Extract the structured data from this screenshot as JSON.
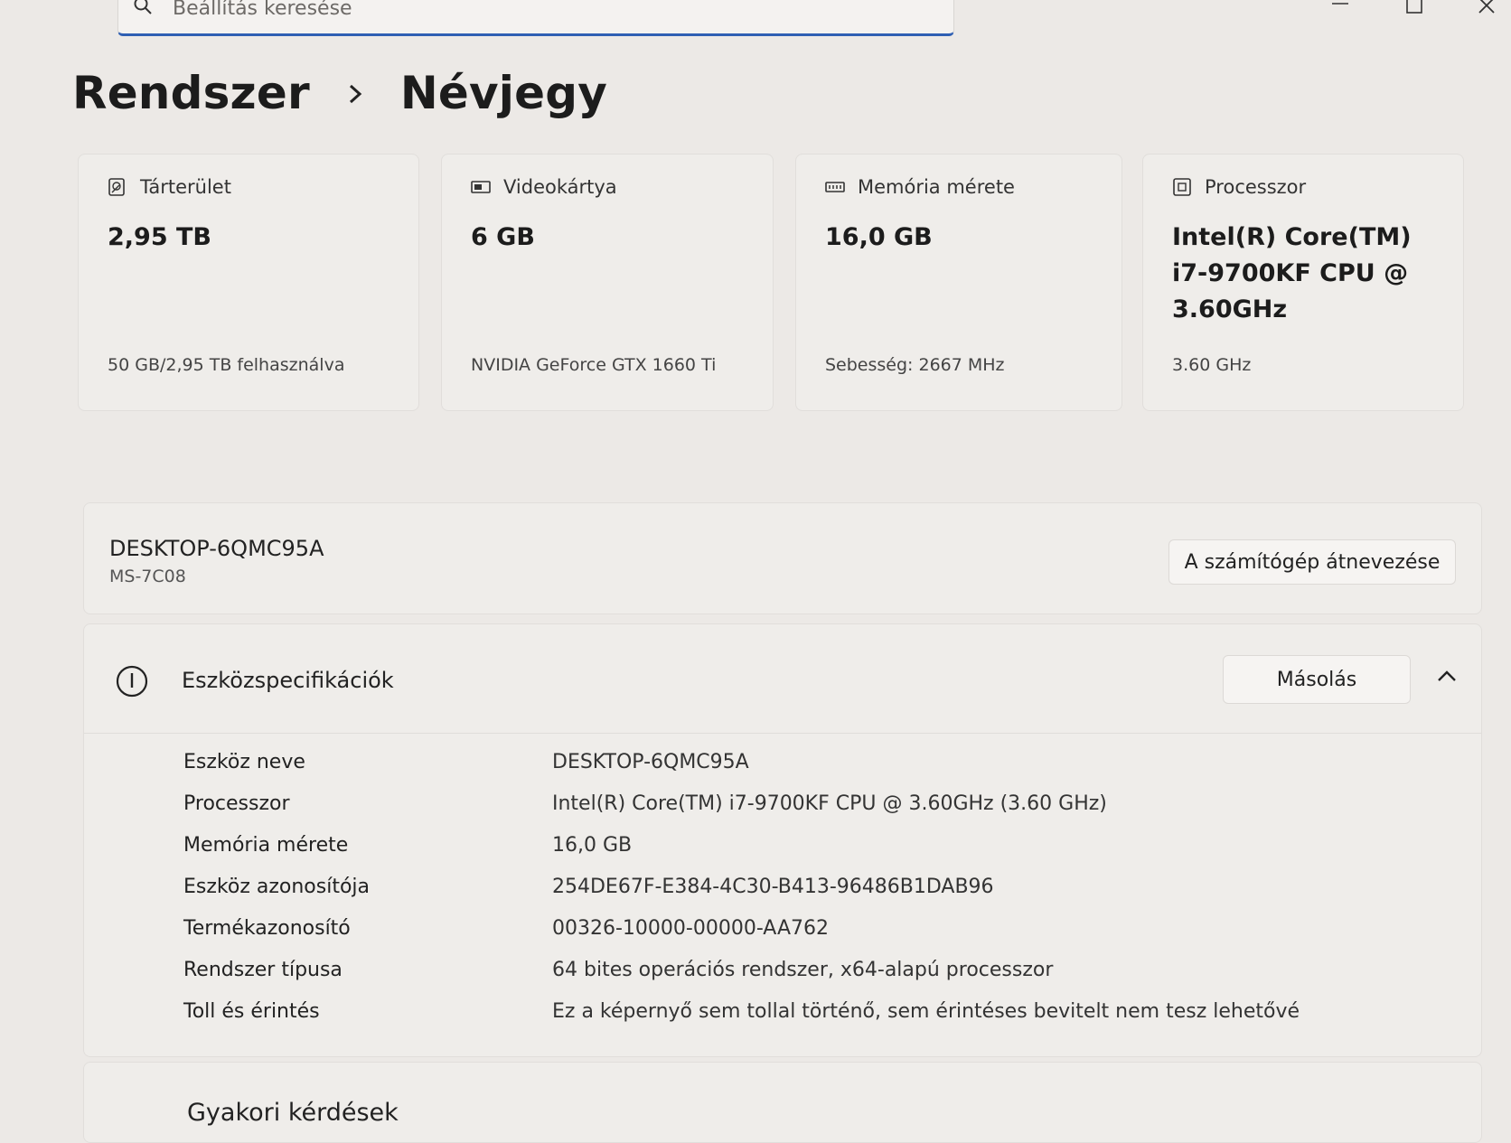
{
  "search": {
    "placeholder": "Beállítás keresése"
  },
  "breadcrumb": {
    "parent": "Rendszer",
    "current": "Névjegy"
  },
  "cards": [
    {
      "icon": "storage-icon",
      "label": "Tárterület",
      "value": "2,95 TB",
      "sub": "50 GB/2,95 TB felhasználva"
    },
    {
      "icon": "gpu-icon",
      "label": "Videokártya",
      "value": "6 GB",
      "sub": "NVIDIA GeForce GTX 1660 Ti"
    },
    {
      "icon": "memory-icon",
      "label": "Memória mérete",
      "value": "16,0 GB",
      "sub": "Sebesség: 2667 MHz"
    },
    {
      "icon": "processor-icon",
      "label": "Processzor",
      "value": "Intel(R) Core(TM) i7-9700KF CPU @ 3.60GHz",
      "sub": "3.60 GHz"
    }
  ],
  "device": {
    "name": "DESKTOP-6QMC95A",
    "model": "MS-7C08",
    "rename_label": "A számítógép átnevezése"
  },
  "specs": {
    "title": "Eszközspecifikációk",
    "copy_label": "Másolás",
    "rows": [
      {
        "key": "Eszköz neve",
        "value": "DESKTOP-6QMC95A"
      },
      {
        "key": "Processzor",
        "value": "Intel(R) Core(TM) i7-9700KF CPU @ 3.60GHz (3.60 GHz)"
      },
      {
        "key": "Memória mérete",
        "value": "16,0 GB"
      },
      {
        "key": "Eszköz azonosítója",
        "value": "254DE67F-E384-4C30-B413-96486B1DAB96"
      },
      {
        "key": "Termékazonosító",
        "value": "00326-10000-00000-AA762"
      },
      {
        "key": "Rendszer típusa",
        "value": "64 bites operációs rendszer, x64-alapú processzor"
      },
      {
        "key": "Toll és érintés",
        "value": "Ez a képernyő sem tollal történő, sem érintéses bevitelt nem tesz lehetővé"
      }
    ]
  },
  "faq": {
    "title": "Gyakori kérdések"
  },
  "colors": {
    "accent": "#2f5fb3",
    "background": "#ece9e6",
    "card": "#efedea"
  }
}
